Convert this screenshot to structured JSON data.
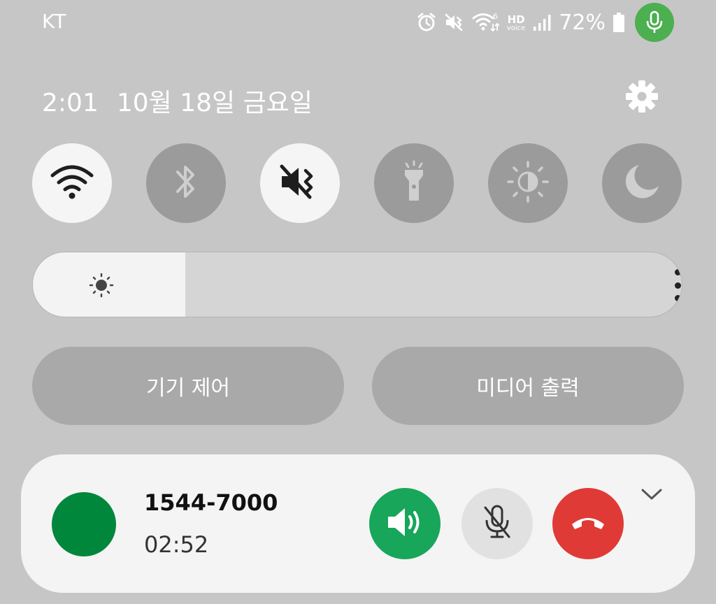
{
  "status_bar": {
    "carrier": "KT",
    "battery": "72%",
    "hd_label": "HD",
    "voice_label": "voice",
    "wifi_badge": "6",
    "icons": [
      "alarm-icon",
      "mute-icon",
      "wifi-6-icon",
      "hd-voice-icon",
      "signal-icon",
      "battery-icon",
      "microphone-icon"
    ]
  },
  "header": {
    "time": "2:01",
    "date": "10월 18일 금요일",
    "settings_icon": "gear-icon"
  },
  "quick_tiles": [
    {
      "name": "wifi",
      "icon": "wifi-icon",
      "active": true
    },
    {
      "name": "bluetooth",
      "icon": "bluetooth-icon",
      "active": false
    },
    {
      "name": "mute",
      "icon": "mute-vibrate-icon",
      "active": true
    },
    {
      "name": "flashlight",
      "icon": "flashlight-icon",
      "active": false
    },
    {
      "name": "eye-comfort",
      "icon": "eye-comfort-icon",
      "active": false
    },
    {
      "name": "dark-mode",
      "icon": "moon-icon",
      "active": false
    }
  ],
  "brightness": {
    "level": 0.235
  },
  "panels": {
    "device_control": "기기 제어",
    "media_output": "미디어 출력"
  },
  "call": {
    "number": "1544-7000",
    "duration": "02:52"
  },
  "colors": {
    "background": "#c6c6c6",
    "tile_on": "#f5f5f5",
    "tile_off": "#9b9b9b",
    "mic_indicator": "#4caf50",
    "avatar": "#00873c",
    "speaker_button": "#17a65a",
    "end_call_button": "#e03a37"
  }
}
